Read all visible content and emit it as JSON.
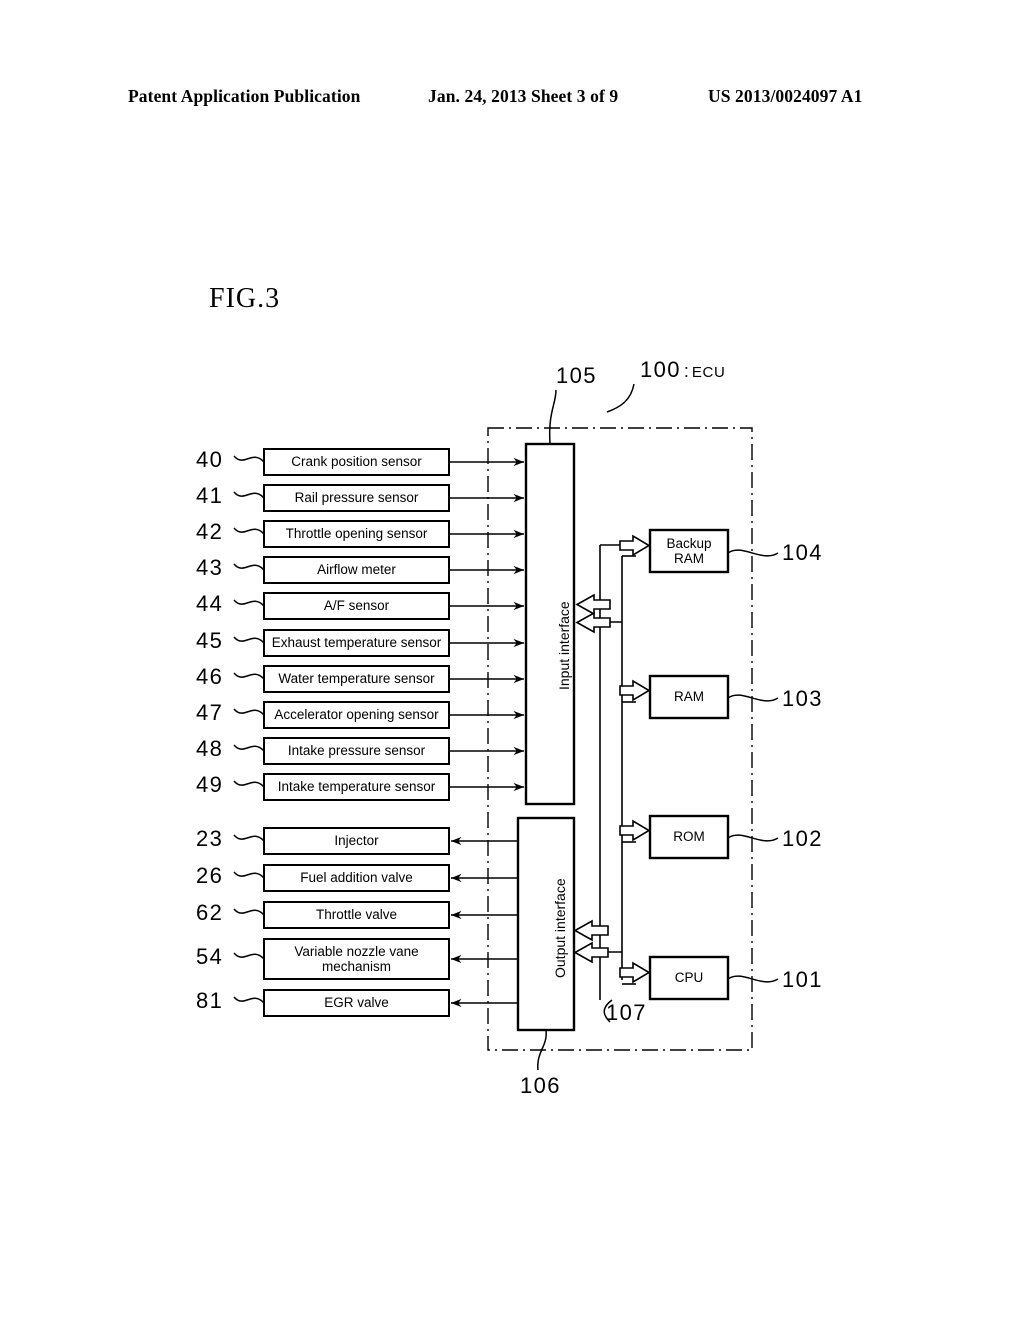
{
  "header": {
    "left": "Patent Application Publication",
    "middle": "Jan. 24, 2013  Sheet 3 of 9",
    "right": "US 2013/0024097 A1"
  },
  "figure": {
    "label": "FIG.3",
    "ecu": {
      "number": "100",
      "separator": ":",
      "abbreviation": "ECU"
    },
    "input_interface": {
      "label": "Input interface",
      "ref": "105"
    },
    "output_interface": {
      "label": "Output interface",
      "ref": "106"
    },
    "bus": {
      "ref": "107"
    },
    "sensors": [
      {
        "ref": "40",
        "label": "Crank position sensor"
      },
      {
        "ref": "41",
        "label": "Rail pressure sensor"
      },
      {
        "ref": "42",
        "label": "Throttle opening sensor"
      },
      {
        "ref": "43",
        "label": "Airflow meter"
      },
      {
        "ref": "44",
        "label": "A/F sensor"
      },
      {
        "ref": "45",
        "label": "Exhaust temperature sensor"
      },
      {
        "ref": "46",
        "label": "Water temperature sensor"
      },
      {
        "ref": "47",
        "label": "Accelerator opening sensor"
      },
      {
        "ref": "48",
        "label": "Intake pressure sensor"
      },
      {
        "ref": "49",
        "label": "Intake temperature sensor"
      }
    ],
    "actuators": [
      {
        "ref": "23",
        "label": "Injector"
      },
      {
        "ref": "26",
        "label": "Fuel addition valve"
      },
      {
        "ref": "62",
        "label": "Throttle valve"
      },
      {
        "ref": "54",
        "label": "Variable nozzle vane mechanism"
      },
      {
        "ref": "81",
        "label": "EGR valve"
      }
    ],
    "memory_units": [
      {
        "ref": "104",
        "label": "Backup RAM"
      },
      {
        "ref": "103",
        "label": "RAM"
      },
      {
        "ref": "102",
        "label": "ROM"
      },
      {
        "ref": "101",
        "label": "CPU"
      }
    ]
  }
}
